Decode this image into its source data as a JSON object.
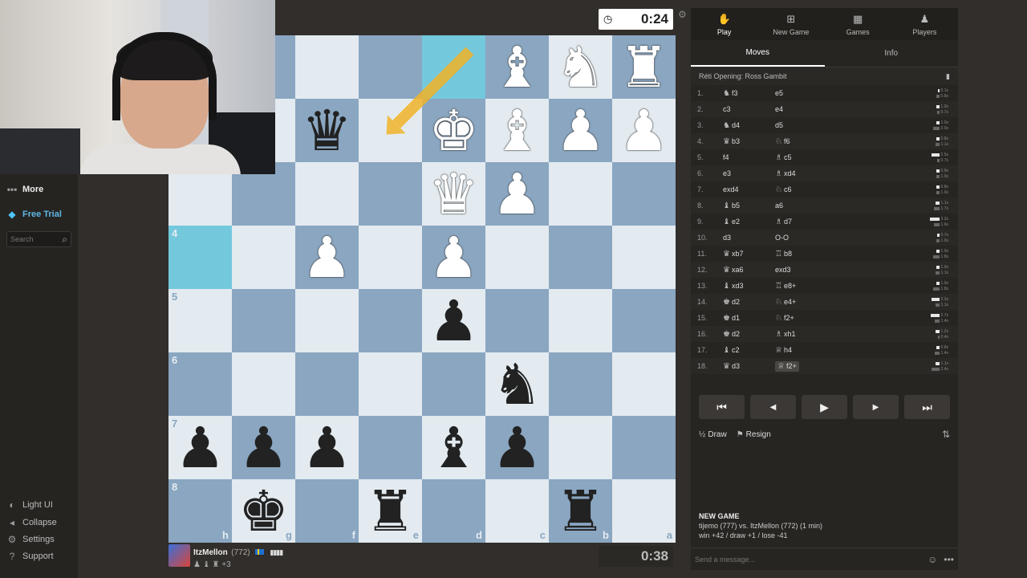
{
  "sidebar": {
    "more": "More",
    "free_trial": "Free Trial",
    "search_placeholder": "Search",
    "light_ui": "Light UI",
    "collapse": "Collapse",
    "settings": "Settings",
    "support": "Support"
  },
  "timers": {
    "top": "0:24",
    "bottom": "0:38"
  },
  "player": {
    "name": "ItzMellon",
    "rating": "(772)",
    "bars": "▮▮▮▮",
    "captures": "♟ ♝ ♜ +3"
  },
  "board": {
    "orientation": "black",
    "files_shown": [
      "h",
      "g",
      "f",
      "e",
      "d",
      "c",
      "b",
      "a"
    ],
    "ranks_shown": [
      "4",
      "5",
      "6",
      "7",
      "8"
    ],
    "highlight_squares": [
      "d1",
      "h4"
    ],
    "arrow": {
      "from": "d1",
      "to": "e2",
      "color": "#f0b429"
    },
    "pieces": [
      {
        "square": "c1",
        "piece": "B",
        "color": "white"
      },
      {
        "square": "b1",
        "piece": "N",
        "color": "white"
      },
      {
        "square": "a1",
        "piece": "R",
        "color": "white"
      },
      {
        "square": "f2",
        "piece": "Q",
        "color": "black"
      },
      {
        "square": "d2",
        "piece": "K",
        "color": "white"
      },
      {
        "square": "c2",
        "piece": "B",
        "color": "white"
      },
      {
        "square": "b2",
        "piece": "P",
        "color": "white"
      },
      {
        "square": "a2",
        "piece": "P",
        "color": "white"
      },
      {
        "square": "d3",
        "piece": "Q",
        "color": "white"
      },
      {
        "square": "c3",
        "piece": "P",
        "color": "white"
      },
      {
        "square": "f4",
        "piece": "P",
        "color": "white"
      },
      {
        "square": "d4",
        "piece": "P",
        "color": "white"
      },
      {
        "square": "d5",
        "piece": "P",
        "color": "black"
      },
      {
        "square": "c6",
        "piece": "N",
        "color": "black"
      },
      {
        "square": "h7",
        "piece": "P",
        "color": "black"
      },
      {
        "square": "g7",
        "piece": "P",
        "color": "black"
      },
      {
        "square": "f7",
        "piece": "P",
        "color": "black"
      },
      {
        "square": "d7",
        "piece": "B",
        "color": "black"
      },
      {
        "square": "c7",
        "piece": "P",
        "color": "black"
      },
      {
        "square": "g8",
        "piece": "K",
        "color": "black"
      },
      {
        "square": "e8",
        "piece": "R",
        "color": "black"
      },
      {
        "square": "b8",
        "piece": "R",
        "color": "black"
      }
    ]
  },
  "panel": {
    "nav": [
      {
        "label": "Play",
        "icon": "hand-icon"
      },
      {
        "label": "New Game",
        "icon": "plus-icon"
      },
      {
        "label": "Games",
        "icon": "board-icon"
      },
      {
        "label": "Players",
        "icon": "people-icon"
      }
    ],
    "subtabs": [
      "Moves",
      "Info"
    ],
    "opening": "Réti Opening: Ross Gambit",
    "moves": [
      {
        "n": "1.",
        "wp": "♞",
        "w": "f3",
        "bp": "",
        "b": "e5",
        "wt": "0.1s",
        "bt": "0.8s"
      },
      {
        "n": "2.",
        "wp": "",
        "w": "c3",
        "bp": "",
        "b": "e4",
        "wt": "1.0s",
        "bt": "0.7s"
      },
      {
        "n": "3.",
        "wp": "♞",
        "w": "d4",
        "bp": "",
        "b": "d5",
        "wt": "1.0s",
        "bt": "2.0s"
      },
      {
        "n": "4.",
        "wp": "♛",
        "w": "b3",
        "bp": "♘",
        "b": "f6",
        "wt": "0.8s",
        "bt": "1.1s"
      },
      {
        "n": "5.",
        "wp": "",
        "w": "f4",
        "bp": "♗",
        "b": "c5",
        "wt": "2.5s",
        "bt": "0.7s"
      },
      {
        "n": "6.",
        "wp": "",
        "w": "e3",
        "bp": "♗",
        "b": "xd4",
        "wt": "0.9s",
        "bt": "1.0s"
      },
      {
        "n": "7.",
        "wp": "",
        "w": "exd4",
        "bp": "♘",
        "b": "c6",
        "wt": "0.8s",
        "bt": "1.0s"
      },
      {
        "n": "8.",
        "wp": "♝",
        "w": "b5",
        "bp": "",
        "b": "a6",
        "wt": "1.1s",
        "bt": "1.7s"
      },
      {
        "n": "9.",
        "wp": "♝",
        "w": "e2",
        "bp": "♗",
        "b": "d7",
        "wt": "3.2s",
        "bt": "1.6s"
      },
      {
        "n": "10.",
        "wp": "",
        "w": "d3",
        "bp": "",
        "b": "O-O",
        "wt": "0.7s",
        "bt": "1.0s"
      },
      {
        "n": "11.",
        "wp": "♛",
        "w": "xb7",
        "bp": "♖",
        "b": "b8",
        "wt": "1.0s",
        "bt": "1.8s"
      },
      {
        "n": "12.",
        "wp": "♛",
        "w": "xa6",
        "bp": "",
        "b": "exd3",
        "wt": "1.0s",
        "bt": "1.1s"
      },
      {
        "n": "13.",
        "wp": "♝",
        "w": "xd3",
        "bp": "♖",
        "b": "e8+",
        "wt": "1.0s",
        "bt": "1.8s"
      },
      {
        "n": "14.",
        "wp": "♚",
        "w": "d2",
        "bp": "♘",
        "b": "e4+",
        "wt": "2.3s",
        "bt": "1.1s"
      },
      {
        "n": "15.",
        "wp": "♚",
        "w": "d1",
        "bp": "♘",
        "b": "f2+",
        "wt": "2.7s",
        "bt": "1.4s"
      },
      {
        "n": "16.",
        "wp": "♚",
        "w": "d2",
        "bp": "♗",
        "b": "xh1",
        "wt": "1.2s",
        "bt": "0.4s"
      },
      {
        "n": "17.",
        "wp": "♝",
        "w": "c2",
        "bp": "♕",
        "b": "h4",
        "wt": "0.8s",
        "bt": "1.4s"
      },
      {
        "n": "18.",
        "wp": "♛",
        "w": "d3",
        "bp": "♕",
        "b": "f2+",
        "wt": "1.1s",
        "bt": "2.4s"
      }
    ],
    "controls": [
      "first-icon",
      "prev-icon",
      "play-icon",
      "next-icon",
      "last-icon"
    ],
    "draw": "Draw",
    "resign": "Resign",
    "game_info": {
      "title": "NEW GAME",
      "line1": "tijemo (777) vs. ItzMellon (772) (1 min)",
      "line2": "win +42 / draw +1 / lose -41"
    },
    "chat_placeholder": "Send a message..."
  },
  "colors": {
    "light_square": "#e3ebf0",
    "dark_square": "#8aa6c1",
    "highlight": "#74c8dc",
    "arrow": "#f0b429"
  }
}
